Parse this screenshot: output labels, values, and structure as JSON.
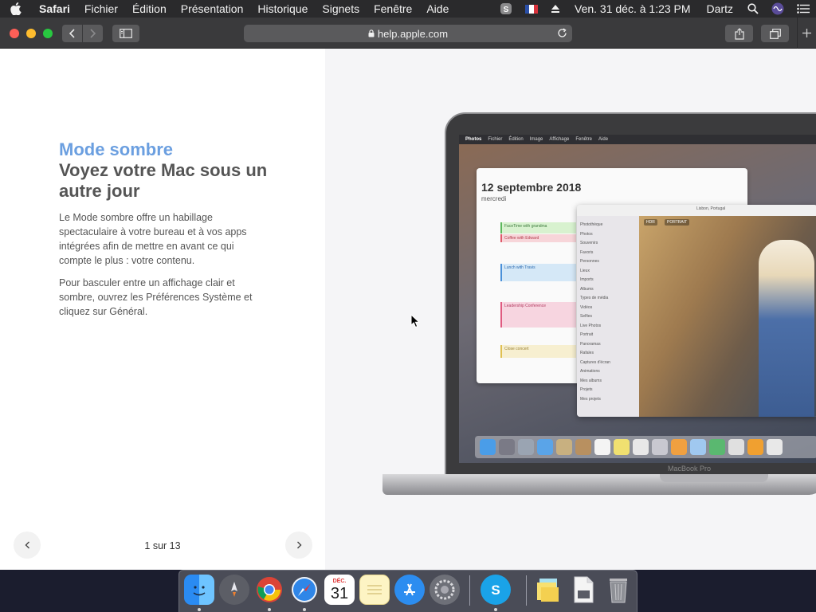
{
  "menubar": {
    "app_name": "Safari",
    "items": [
      "Fichier",
      "Édition",
      "Présentation",
      "Historique",
      "Signets",
      "Fenêtre",
      "Aide"
    ],
    "clock": "Ven. 31 déc. à  1:23 PM",
    "user": "Dartz"
  },
  "browser": {
    "url": "help.apple.com"
  },
  "page": {
    "eyebrow": "Mode sombre",
    "headline": "Voyez votre Mac sous un autre jour",
    "paragraph1": "Le Mode sombre offre un habillage spectaculaire à votre bureau et à vos apps intégrées afin de mettre en avant ce qui compte le plus : votre contenu.",
    "paragraph2": "Pour basculer entre un affichage clair et sombre, ouvrez les Préférences Système et cliquez sur Général.",
    "pager": "1 sur 13"
  },
  "illustration": {
    "screen_menubar": {
      "app": "Photos",
      "items": [
        "Fichier",
        "Édition",
        "Image",
        "Affichage",
        "Fenêtre",
        "Aide"
      ]
    },
    "calendar": {
      "date": "12 septembre 2018",
      "weekday": "mercredi",
      "events": [
        "FaceTime with grandma",
        "Coffee with Edward",
        "Lunch with Travis",
        "Leadership Conference",
        "Close concert"
      ]
    },
    "photos": {
      "sidebar_items": [
        "Photothèque",
        "Photos",
        "Souvenirs",
        "Favoris",
        "Personnes",
        "Lieux",
        "Imports",
        "Albums",
        "Types de média",
        "Vidéos",
        "Selfies",
        "Live Photos",
        "Portrait",
        "Panoramas",
        "Rafales",
        "Captures d'écran",
        "Animations",
        "Mes albums",
        "Projets",
        "Mes projets"
      ],
      "location": "Lisbon, Portugal",
      "badges": [
        "HDR",
        "PORTRAIT"
      ]
    },
    "laptop_label": "MacBook Pro"
  },
  "dock": {
    "apps": [
      "Finder",
      "Launchpad",
      "Google Chrome",
      "Safari",
      "Calendrier",
      "Notes",
      "App Store",
      "Préférences Système",
      "Skype",
      "Notes autocollantes",
      "Aperçu",
      "Corbeille"
    ],
    "calendar_icon": {
      "month": "DÉC.",
      "day": "31"
    }
  },
  "colors": {
    "accent": "#6b9fe0",
    "menubar_bg": "#2a2a2c",
    "toolbar_bg": "#3a3a3c"
  }
}
